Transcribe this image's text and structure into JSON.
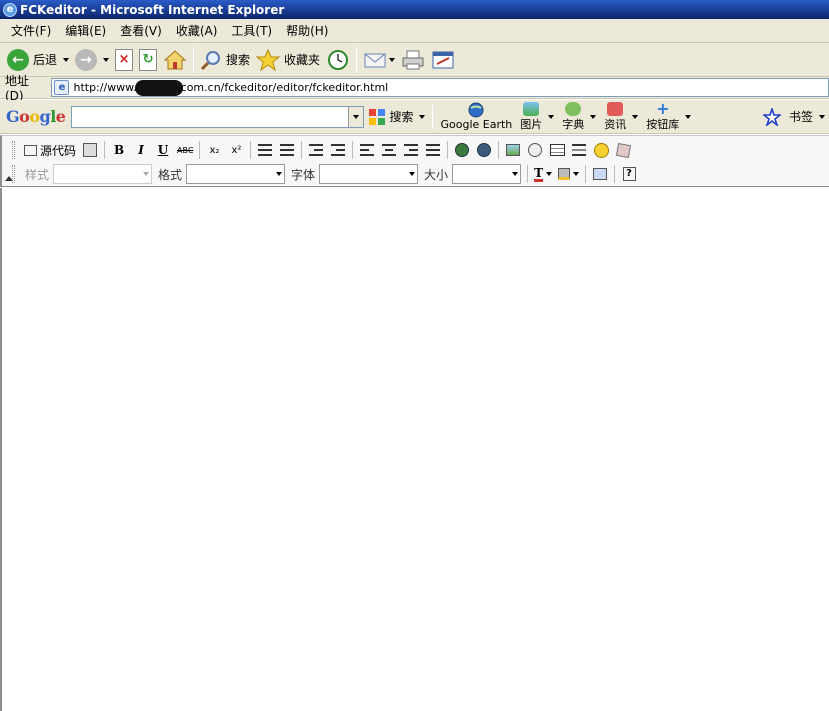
{
  "window": {
    "title": "FCKeditor - Microsoft Internet Explorer"
  },
  "menubar": {
    "items": [
      "文件(F)",
      "编辑(E)",
      "查看(V)",
      "收藏(A)",
      "工具(T)",
      "帮助(H)"
    ]
  },
  "toolbar": {
    "back_label": "后退",
    "search_label": "搜索",
    "favorites_label": "收藏夹"
  },
  "addressbar": {
    "label": "地址(D)",
    "url_prefix": "http://www.",
    "url_suffix": "com.cn/fckeditor/editor/fckeditor.html"
  },
  "googlebar": {
    "logo": "Google",
    "search_value": "",
    "search_button": "搜索",
    "earth_label": "Google Earth",
    "images_label": "图片",
    "dictionary_label": "字典",
    "news_label": "资讯",
    "buttons_label": "按钮库",
    "bookmarks_label": "书签"
  },
  "fck": {
    "source_label": "源代码",
    "style_label": "样式",
    "format_label": "格式",
    "font_label": "字体",
    "size_label": "大小",
    "style_value": "",
    "format_value": "",
    "font_value": "",
    "size_value": "",
    "bold_glyph": "B",
    "italic_glyph": "I",
    "underline_glyph": "U",
    "strike_glyph": "ABC",
    "subscript_glyph": "x₂",
    "superscript_glyph": "x²"
  },
  "colors": {
    "title_bar": "#0a246a",
    "chrome": "#ece9d8",
    "fck_toolbar": "#f7f7f7",
    "editor_bg": "#ffffff"
  }
}
